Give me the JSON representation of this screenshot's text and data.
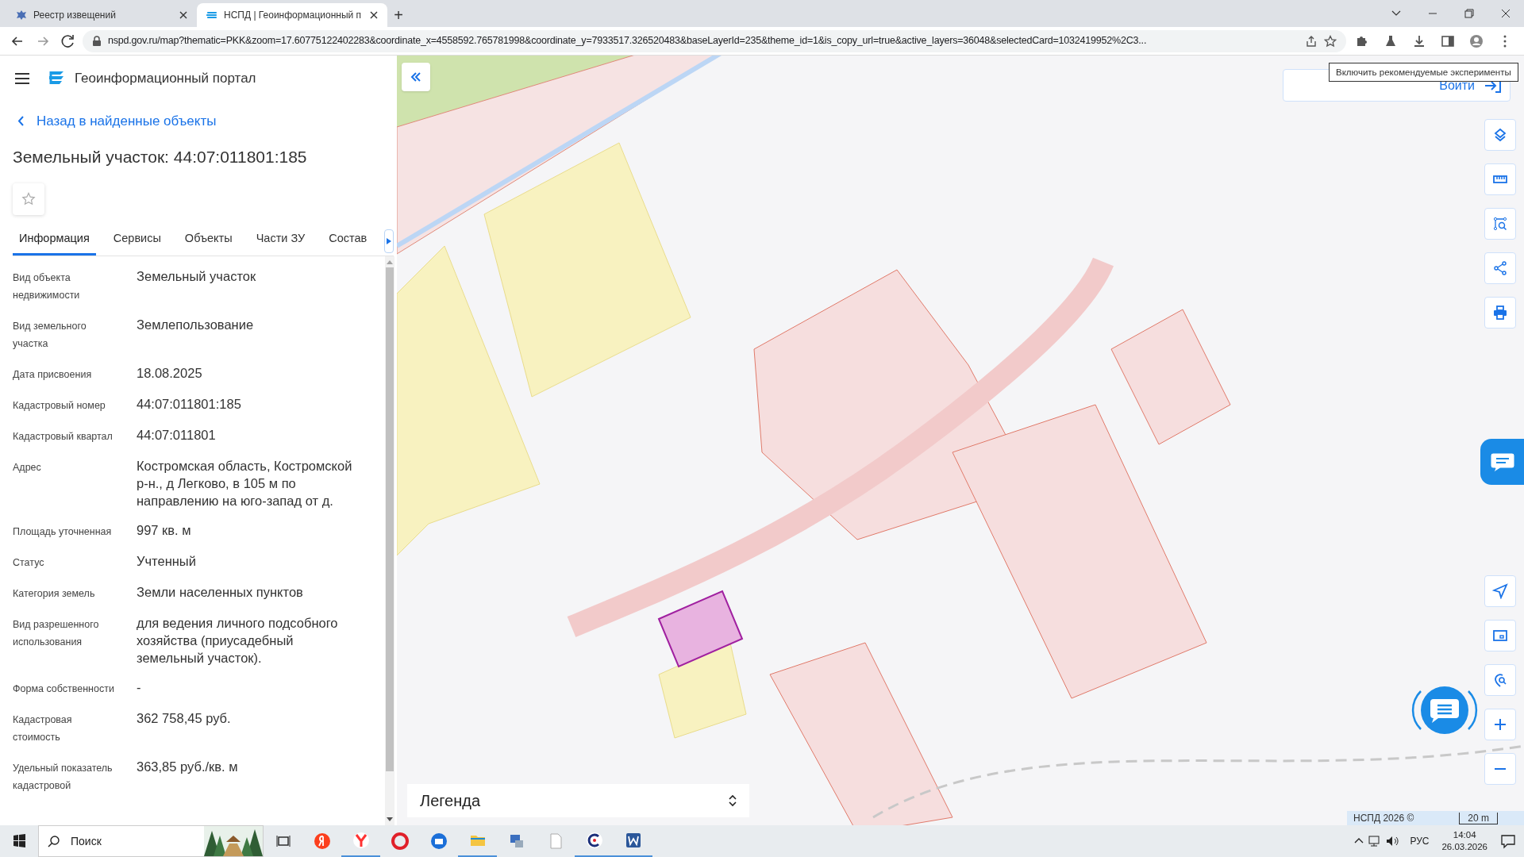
{
  "browser": {
    "tabs": [
      {
        "title": "Реестр извещений",
        "selected": false
      },
      {
        "title": "НСПД | Геоинформационный п",
        "selected": true
      }
    ],
    "new_tab": "+",
    "url": "nspd.gov.ru/map?thematic=PKK&zoom=17.60775122402283&coordinate_x=4558592.765781998&coordinate_y=7933517.326520483&baseLayerId=235&theme_id=1&is_copy_url=true&active_layers=36048&selectedCard=1032419952%2C3..."
  },
  "portal": {
    "title": "Геоинформационный портал",
    "back_link": "Назад в найденные объекты",
    "heading": "Земельный участок: 44:07:011801:185",
    "favorite": false,
    "tabs": [
      {
        "label": "Информация",
        "selected": true
      },
      {
        "label": "Сервисы",
        "selected": false
      },
      {
        "label": "Объекты",
        "selected": false
      },
      {
        "label": "Части ЗУ",
        "selected": false
      },
      {
        "label": "Состав",
        "selected": false
      }
    ],
    "fields": [
      {
        "label": "Вид объекта недвижимости",
        "value": "Земельный участок"
      },
      {
        "label": "Вид земельного участка",
        "value": "Землепользование"
      },
      {
        "label": "Дата присвоения",
        "value": "18.08.2025"
      },
      {
        "label": "Кадастровый номер",
        "value": "44:07:011801:185"
      },
      {
        "label": "Кадастровый квартал",
        "value": "44:07:011801"
      },
      {
        "label": "Адрес",
        "value": "Костромская область, Костромской р-н., д Легково, в 105 м по направлению на юго-запад от д."
      },
      {
        "label": "Площадь уточненная",
        "value": "997 кв. м"
      },
      {
        "label": "Статус",
        "value": "Учтенный"
      },
      {
        "label": "Категория земель",
        "value": "Земли населенных пунктов"
      },
      {
        "label": "Вид разрешенного использования",
        "value": "для ведения личного подсобного хозяйства (приусадебный земельный участок)."
      },
      {
        "label": "Форма собственности",
        "value": "-"
      },
      {
        "label": "Кадастровая стоимость",
        "value": "362 758,45 руб."
      },
      {
        "label": "Удельный показатель кадастровой",
        "value": "363,85 руб./кв. м"
      }
    ]
  },
  "map": {
    "kind": "picture",
    "login": "Войти",
    "tooltip": "Включить рекомендуемые эксперименты",
    "legend": "Легенда",
    "attribution": "НСПД 2026 ©",
    "scale": "20 m"
  },
  "taskbar": {
    "search_placeholder": "Поиск",
    "language": "РУС",
    "time": "14:04",
    "date": "26.03.2026"
  }
}
